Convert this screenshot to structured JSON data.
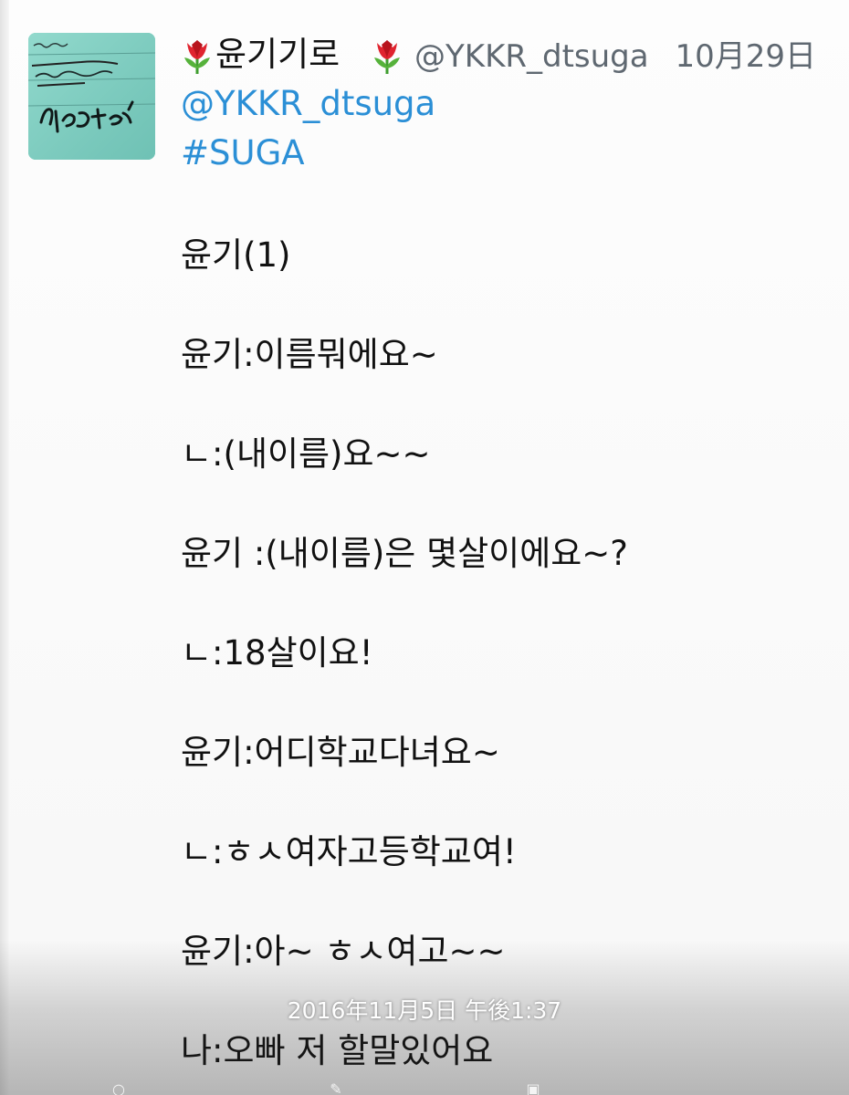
{
  "tweet": {
    "display_name": "윤기기로",
    "handle": "@YKKR_dtsuga",
    "date": "10月29日",
    "mention": "@YKKR_dtsuga",
    "hashtag": "#SUGA",
    "lines": [
      "윤기(1)",
      "윤기:이름뭐에요~",
      "ㄴ:(내이름)요~~",
      "윤기 :(내이름)은 몇살이에요~?",
      "ㄴ:18살이요!",
      "윤기:어디학교다녀요~",
      "ㄴ:ㅎㅅ여자고등학교여!",
      "윤기:아~ ㅎㅅ여고~~",
      "나:오빠 저 할말있어요"
    ]
  },
  "gallery": {
    "timestamp": "2016年11月5日 午後1:37"
  },
  "icons": {
    "avatar": "handwritten-note-avatar",
    "flower": "tulip-emoji",
    "toolbar": [
      "share-icon",
      "edit-icon",
      "info-icon"
    ]
  },
  "colors": {
    "link": "#2b8fd6",
    "meta": "#5f6871",
    "text": "#111111",
    "avatar_bg": "#7fcfc1"
  }
}
